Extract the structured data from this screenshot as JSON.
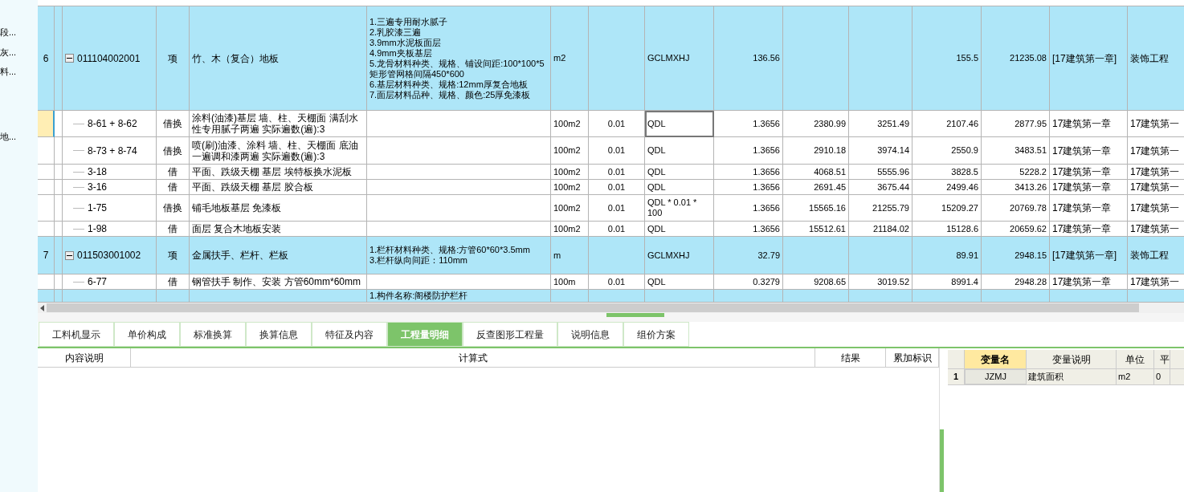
{
  "sidebar": {
    "items": [
      "段...",
      "灰...",
      "料...",
      "地..."
    ]
  },
  "table": {
    "rows": [
      {
        "kind": "item",
        "num": "6",
        "expanded": true,
        "selected": false,
        "code": "011104002001",
        "type": "项",
        "name": "竹、木（复合）地板",
        "features": [
          "1.三遍专用耐水腻子",
          "2.乳胶漆三遍",
          "3.9mm水泥板面层",
          "4.9mm夹板基层",
          "5.龙骨材料种类、规格、铺设间距:100*100*5矩形管网格间隔450*600",
          "6.基层材料种类、规格:12mm厚复合地板",
          "7.面层材料品种、规格、颜色:25厚免漆板"
        ],
        "unit": "m2",
        "content": "",
        "formula": "GCLMXHJ",
        "cells": [
          "136.56",
          "",
          "",
          "155.5",
          "21235.08",
          "[17建筑第一章]",
          "装饰工程"
        ]
      },
      {
        "kind": "sub",
        "num": "",
        "selected": true,
        "code": "8-61 + 8-62",
        "type": "借换",
        "name": "涂料(油漆)基层 墙、柱、天棚面 满刮水性专用腻子两遍 实际遍数(遍):3",
        "features": [],
        "unit": "100m2",
        "content": "0.01",
        "formula": "QDL",
        "cells": [
          "1.3656",
          "2380.99",
          "3251.49",
          "2107.46",
          "2877.95",
          "17建筑第一章",
          "17建筑第一"
        ]
      },
      {
        "kind": "sub",
        "num": "",
        "selected": false,
        "code": "8-73 + 8-74",
        "type": "借换",
        "name": "喷(刷)油漆、涂料 墙、柱、天棚面 底油一遍调和漆两遍  实际遍数(遍):3",
        "features": [],
        "unit": "100m2",
        "content": "0.01",
        "formula": "QDL",
        "cells": [
          "1.3656",
          "2910.18",
          "3974.14",
          "2550.9",
          "3483.51",
          "17建筑第一章",
          "17建筑第一"
        ]
      },
      {
        "kind": "sub",
        "num": "",
        "selected": false,
        "code": "3-18",
        "type": "借",
        "name": "平面、跌级天棚 基层 埃特板换水泥板",
        "features": [],
        "unit": "100m2",
        "content": "0.01",
        "formula": "QDL",
        "cells": [
          "1.3656",
          "4068.51",
          "5555.96",
          "3828.5",
          "5228.2",
          "17建筑第一章",
          "17建筑第一"
        ]
      },
      {
        "kind": "sub",
        "num": "",
        "selected": false,
        "code": "3-16",
        "type": "借",
        "name": "平面、跌级天棚 基层 胶合板",
        "features": [],
        "unit": "100m2",
        "content": "0.01",
        "formula": "QDL",
        "cells": [
          "1.3656",
          "2691.45",
          "3675.44",
          "2499.46",
          "3413.26",
          "17建筑第一章",
          "17建筑第一"
        ]
      },
      {
        "kind": "sub",
        "num": "",
        "selected": false,
        "code": "1-75",
        "type": "借换",
        "name": "铺毛地板基层 免漆板",
        "features": [],
        "unit": "100m2",
        "content": "0.01",
        "formula": "QDL * 0.01 * 100",
        "cells": [
          "1.3656",
          "15565.16",
          "21255.79",
          "15209.27",
          "20769.78",
          "17建筑第一章",
          "17建筑第一"
        ]
      },
      {
        "kind": "sub",
        "num": "",
        "selected": false,
        "code": "1-98",
        "type": "借",
        "name": "面层 复合木地板安装",
        "features": [],
        "unit": "100m2",
        "content": "0.01",
        "formula": "QDL",
        "cells": [
          "1.3656",
          "15512.61",
          "21184.02",
          "15128.6",
          "20659.62",
          "17建筑第一章",
          "17建筑第一"
        ]
      },
      {
        "kind": "item",
        "num": "7",
        "expanded": true,
        "selected": false,
        "code": "011503001002",
        "type": "项",
        "name": "金属扶手、栏杆、栏板",
        "features": [
          "1.栏杆材料种类、规格:方管60*60*3.5mm",
          "3.栏杆纵向间距：110mm"
        ],
        "unit": "m",
        "content": "",
        "formula": "GCLMXHJ",
        "cells": [
          "32.79",
          "",
          "",
          "89.91",
          "2948.15",
          "[17建筑第一章]",
          "装饰工程"
        ]
      },
      {
        "kind": "sub",
        "num": "",
        "selected": false,
        "code": "6-77",
        "type": "借",
        "name": "钢管扶手 制作、安装 方管60mm*60mm",
        "features": [],
        "unit": "100m",
        "content": "0.01",
        "formula": "QDL",
        "cells": [
          "0.3279",
          "9208.65",
          "3019.52",
          "8991.4",
          "2948.28",
          "17建筑第一章",
          "17建筑第一"
        ]
      },
      {
        "kind": "partial",
        "num": "",
        "selected": false,
        "code": "",
        "type": "",
        "name": "",
        "features": [
          "1.构件名称:阁楼防护栏杆"
        ],
        "unit": "",
        "content": "",
        "formula": "",
        "cells": [
          "",
          "",
          "",
          "",
          "",
          "",
          ""
        ]
      }
    ]
  },
  "tabs": [
    {
      "label": "工料机显示",
      "selected": false
    },
    {
      "label": "单价构成",
      "selected": false
    },
    {
      "label": "标准换算",
      "selected": false
    },
    {
      "label": "换算信息",
      "selected": false
    },
    {
      "label": "特征及内容",
      "selected": false
    },
    {
      "label": "工程量明细",
      "selected": true
    },
    {
      "label": "反查图形工程量",
      "selected": false
    },
    {
      "label": "说明信息",
      "selected": false
    },
    {
      "label": "组价方案",
      "selected": false
    }
  ],
  "detail": {
    "columns": [
      "内容说明",
      "计算式",
      "结果",
      "累加标识"
    ]
  },
  "variables": {
    "columns": [
      "变量名",
      "变量说明",
      "单位",
      "平"
    ],
    "rows": [
      {
        "num": "1",
        "cells": [
          "JZMJ",
          "建筑面积",
          "m2",
          "0"
        ]
      }
    ]
  }
}
